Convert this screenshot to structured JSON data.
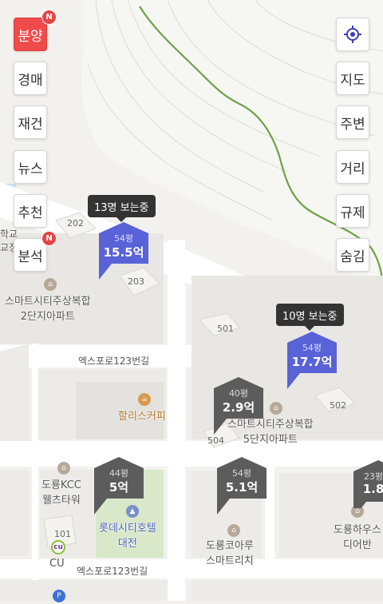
{
  "left_menu": [
    {
      "label": "분양",
      "active": true,
      "badge": "N"
    },
    {
      "label": "경매"
    },
    {
      "label": "재건"
    },
    {
      "label": "뉴스"
    },
    {
      "label": "추천"
    },
    {
      "label": "분석",
      "badge": "N"
    }
  ],
  "right_menu": [
    "지도",
    "주변",
    "거리",
    "규제",
    "숨김"
  ],
  "colors": {
    "active": "#ef4b4b",
    "marker_blue": "#5962d6",
    "marker_dark": "#5c5c5c",
    "viewer_bg": "#333333"
  },
  "viewers": [
    {
      "text": "13명 보는중"
    },
    {
      "text": "10명 보는중"
    }
  ],
  "markers": [
    {
      "size": "54평",
      "price": "15.5억",
      "style": "blue"
    },
    {
      "size": "54평",
      "price": "17.7억",
      "style": "blue"
    },
    {
      "size": "40평",
      "price": "2.9억",
      "style": "dark"
    },
    {
      "size": "44평",
      "price": "5억",
      "style": "dark"
    },
    {
      "size": "54평",
      "price": "5.1억",
      "style": "dark"
    },
    {
      "size": "23평",
      "price": "1.8",
      "style": "dark"
    }
  ],
  "places": [
    {
      "line1": "스마트시티주상복합",
      "line2": "2단지아파트"
    },
    {
      "line1": "스마트시티주상복합",
      "line2": "5단지아파트"
    },
    {
      "line1": "할리스커피",
      "line2": ""
    },
    {
      "line1": "도룡KCC",
      "line2": "웰츠타워"
    },
    {
      "line1": "롯데시티호텔",
      "line2": "대전"
    },
    {
      "line1": "도룡코아루",
      "line2": "스마트리치"
    },
    {
      "line1": "도룡하우스",
      "line2": "디어반"
    },
    {
      "line1": "학교",
      "line2": "교정"
    }
  ],
  "buildings": [
    "202",
    "203",
    "501",
    "502",
    "504",
    "101"
  ],
  "streets": [
    "엑스포로123번길",
    "엑스포로123번길"
  ],
  "poi_labels": {
    "cu": "CU"
  },
  "icons": {
    "locate": "crosshair-icon"
  }
}
